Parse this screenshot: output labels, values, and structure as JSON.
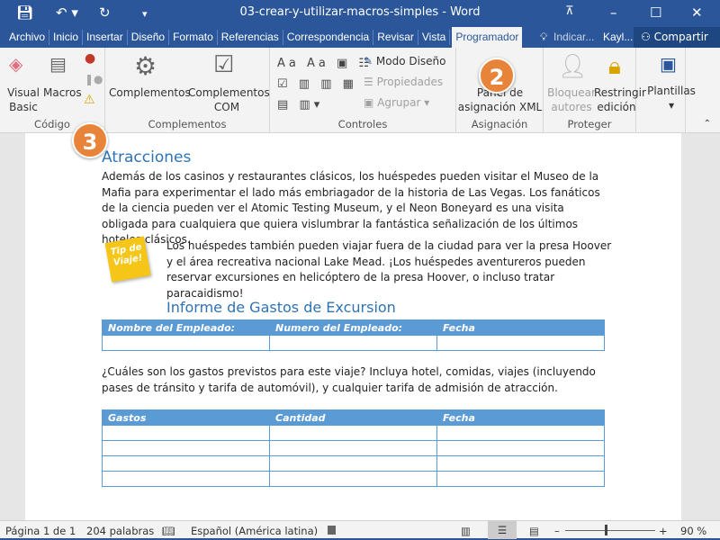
{
  "titlebar": {
    "title": "03-crear-y-utilizar-macros-simples  -  Word"
  },
  "tabs": [
    "Archivo",
    "Inicio",
    "Insertar",
    "Diseño",
    "Formato",
    "Referencias",
    "Correspondencia",
    "Revisar",
    "Vista",
    "Programador"
  ],
  "tell_me": "Indicar...",
  "user": "Kayl...",
  "share": "Compartir",
  "ribbon": {
    "codigo": {
      "label": "Código",
      "vb": "Visual Basic",
      "macros": "Macros"
    },
    "complementos": {
      "label": "Complementos",
      "c1": "Complementos",
      "c2": "Complementos COM"
    },
    "controles": {
      "label": "Controles",
      "modo": "Modo Diseño",
      "prop": "Propiedades",
      "agrupar": "Agrupar"
    },
    "asignacion": {
      "label": "Asignación",
      "panel": "Panel de asignación XML"
    },
    "proteger": {
      "label": "Proteger",
      "bloquear": "Bloquear autores",
      "restringir": "Restringir edición"
    },
    "plantillas": {
      "label": "Plantillas"
    }
  },
  "document": {
    "h1": "Atracciones",
    "p1": "Además de los casinos y restaurantes clásicos, los huéspedes pueden visitar el Museo de la Mafia para experimentar el lado más embriagador de la historia de Las Vegas. Los fanáticos de la ciencia pueden ver el Atomic Testing Museum, y el Neon Boneyard es una visita obligada para cualquiera que quiera vislumbrar la fantástica señalización de los últimos hoteles clásicos.",
    "tip": "Tip de Viaje!",
    "p2": "Los huéspedes también pueden viajar fuera de la ciudad para ver la presa Hoover y el área recreativa nacional Lake Mead. ¡Los huéspedes aventureros pueden reservar excursiones en helicóptero de la presa Hoover, o incluso tratar paracaidismo!",
    "h2": "Informe de Gastos de Excursion",
    "table1": {
      "headers": [
        "Nombre del Empleado:",
        "Numero del Empleado:",
        "Fecha"
      ]
    },
    "p3": "¿Cuáles son los gastos previstos para este viaje? Incluya hotel, comidas, viajes (incluyendo pases de tránsito y tarifa de automóvil), y cualquier tarifa de admisión de atracción.",
    "table2": {
      "headers": [
        "Gastos",
        "Cantidad",
        "Fecha"
      ]
    }
  },
  "callouts": [
    "2",
    "3"
  ],
  "status": {
    "page": "Página 1 de 1",
    "words": "204 palabras",
    "lang": "Español (América latina)",
    "zoom": "90 %",
    "zoom_percent": 90
  },
  "colors": {
    "brand": "#2b579a",
    "accent": "#e8833a",
    "table": "#5b9bd5",
    "heading": "#2e74b5"
  }
}
